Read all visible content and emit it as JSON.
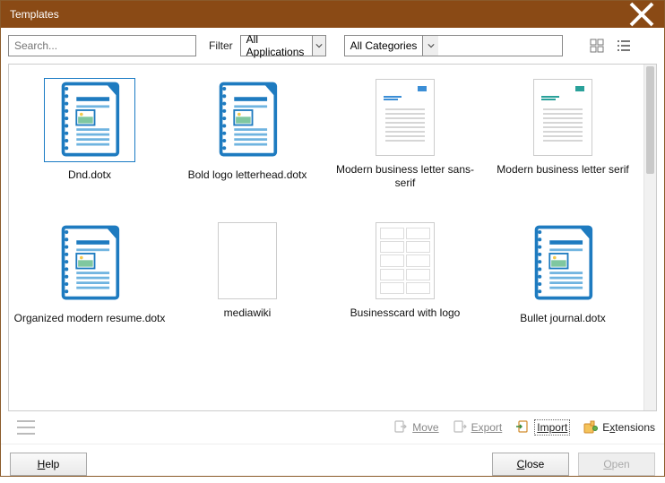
{
  "window": {
    "title": "Templates"
  },
  "toolbar": {
    "search_placeholder": "Search...",
    "filter_label": "Filter",
    "app_combo": "All Applications",
    "cat_combo": "All Categories"
  },
  "items": [
    {
      "label": "Dnd.dotx",
      "kind": "doc",
      "selected": true
    },
    {
      "label": "Bold logo letterhead.dotx",
      "kind": "doc"
    },
    {
      "label": "Modern business letter sans-serif",
      "kind": "letter-blue"
    },
    {
      "label": "Modern business letter serif",
      "kind": "letter-teal"
    },
    {
      "label": "Organized modern resume.dotx",
      "kind": "doc"
    },
    {
      "label": "mediawiki",
      "kind": "blank"
    },
    {
      "label": "Businesscard with logo",
      "kind": "cards"
    },
    {
      "label": "Bullet journal.dotx",
      "kind": "doc"
    }
  ],
  "actions": {
    "move": "Move",
    "export": "Export",
    "import": "Import",
    "extensions": "Extensions"
  },
  "footer": {
    "help": "Help",
    "close": "Close",
    "open": "Open"
  }
}
